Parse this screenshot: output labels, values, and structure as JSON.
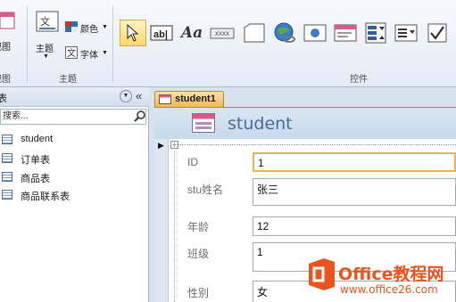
{
  "ribbon": {
    "view_label": "视图",
    "view_group": "视图",
    "theme_button": "主题",
    "colors_label": "颜色",
    "fonts_label": "字体",
    "theme_group": "主题",
    "controls_group": "控件"
  },
  "nav": {
    "search_placeholder": "搜索...",
    "items": [
      {
        "label": "student",
        "icon": "table-icon"
      },
      {
        "label": "订单表",
        "icon": "table-icon"
      },
      {
        "label": "商品表",
        "icon": "table-icon"
      },
      {
        "label": "商品联系表",
        "icon": "table-icon"
      }
    ]
  },
  "document": {
    "tab_label": "student1",
    "form_title": "student",
    "fields": [
      {
        "label": "ID",
        "value": "1"
      },
      {
        "label": "stu姓名",
        "value": "张三"
      },
      {
        "label": "年龄",
        "value": "12"
      },
      {
        "label": "班级",
        "value": "1"
      },
      {
        "label": "性别",
        "value": "女"
      }
    ]
  },
  "watermark": {
    "brand": "Office教程网",
    "url": "www.office26.com"
  },
  "colors": {
    "ribbon_bg": "#e4ebf5",
    "tab_accent": "#f0b856",
    "active_field_border": "#f0b050",
    "watermark": "#e8541c"
  }
}
